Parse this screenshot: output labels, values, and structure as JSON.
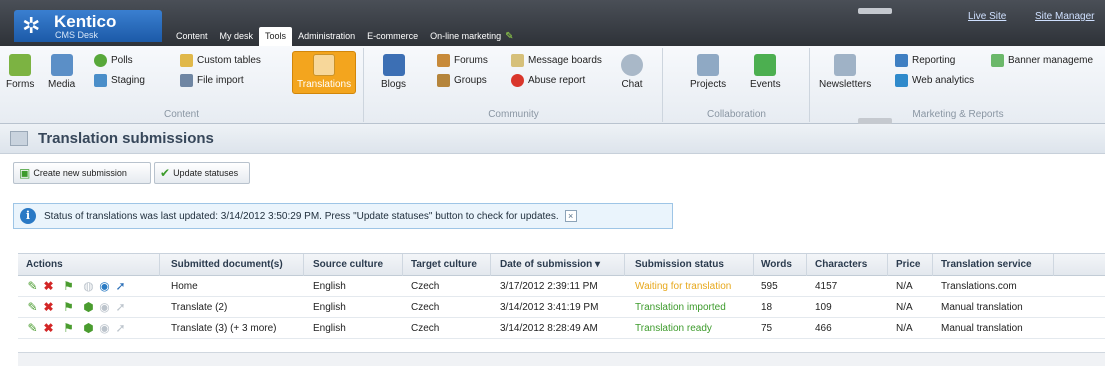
{
  "app": {
    "brand": "Kentico",
    "product": "CMS Desk",
    "menu": [
      "Content",
      "My desk",
      "Tools",
      "Administration",
      "E-commerce",
      "On-line marketing"
    ],
    "active_menu": "Tools",
    "links": {
      "live_site": "Live Site",
      "site_manager": "Site Manager"
    }
  },
  "ribbon": {
    "content": {
      "label": "Content",
      "forms": "Forms",
      "media": "Media",
      "polls": "Polls",
      "staging": "Staging",
      "custom_tables": "Custom tables",
      "file_import": "File import",
      "translations": "Translations"
    },
    "community": {
      "label": "Community",
      "blogs": "Blogs",
      "forums": "Forums",
      "groups": "Groups",
      "message_boards": "Message boards",
      "abuse_report": "Abuse report",
      "chat": "Chat"
    },
    "collaboration": {
      "label": "Collaboration",
      "projects": "Projects",
      "events": "Events"
    },
    "marketing": {
      "label": "Marketing & Reports",
      "newsletters": "Newsletters",
      "reporting": "Reporting",
      "web_analytics": "Web analytics",
      "banner": "Banner manageme"
    }
  },
  "page": {
    "title": "Translation submissions"
  },
  "toolbar": {
    "create": "Create new submission",
    "update": "Update statuses"
  },
  "info": {
    "message": "Status of translations was last updated: 3/14/2012 3:50:29 PM. Press \"Update statuses\" button to check for updates.",
    "close": "×"
  },
  "grid": {
    "headers": {
      "actions": "Actions",
      "document": "Submitted document(s)",
      "source": "Source culture",
      "target": "Target culture",
      "date": "Date of submission ▾",
      "status": "Submission status",
      "words": "Words",
      "chars": "Characters",
      "price": "Price",
      "service": "Translation service"
    },
    "rows": [
      {
        "document": "Home",
        "source": "English",
        "target": "Czech",
        "date": "3/17/2012 2:39:11 PM",
        "status": "Waiting for translation",
        "status_color": "#e7a81c",
        "words": "595",
        "chars": "4157",
        "price": "N/A",
        "service": "Translations.com"
      },
      {
        "document": "Translate (2)",
        "source": "English",
        "target": "Czech",
        "date": "3/14/2012 3:41:19 PM",
        "status": "Translation imported",
        "status_color": "#3d9b2c",
        "words": "18",
        "chars": "109",
        "price": "N/A",
        "service": "Manual translation"
      },
      {
        "document": "Translate (3) (+ 3 more)",
        "source": "English",
        "target": "Czech",
        "date": "3/14/2012 8:28:49 AM",
        "status": "Translation ready",
        "status_color": "#3d9b2c",
        "words": "75",
        "chars": "466",
        "price": "N/A",
        "service": "Manual translation"
      }
    ]
  },
  "colors": {
    "accent": "#f3a51e",
    "header": "#3a3f46",
    "link": "#cfe0ff"
  }
}
